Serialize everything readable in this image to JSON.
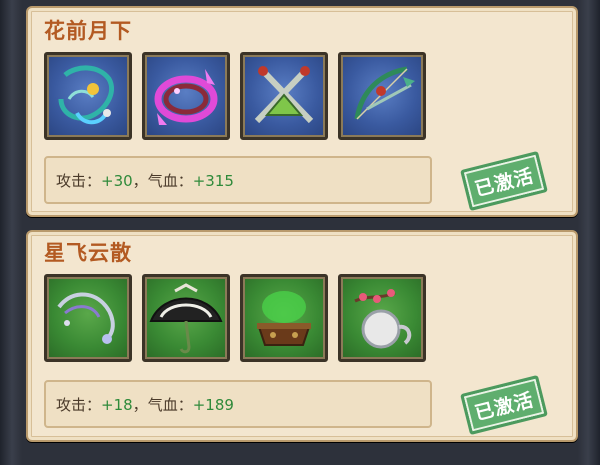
{
  "sets": [
    {
      "title": "花前月下",
      "items": [
        {
          "icon": "jade-pendant-icon",
          "bg": "blue"
        },
        {
          "icon": "purple-ring-blade-icon",
          "bg": "blue"
        },
        {
          "icon": "crossed-swords-icon",
          "bg": "blue"
        },
        {
          "icon": "bow-icon",
          "bg": "blue"
        }
      ],
      "stats": {
        "attack_label": "攻击：",
        "attack_value": "+30",
        "sep": "，",
        "hp_label": "气血：",
        "hp_value": "+315"
      },
      "status": "已激活"
    },
    {
      "title": "星飞云散",
      "items": [
        {
          "icon": "silver-whip-icon",
          "bg": "green"
        },
        {
          "icon": "umbrella-icon",
          "bg": "green"
        },
        {
          "icon": "cauldron-icon",
          "bg": "green"
        },
        {
          "icon": "blossom-orb-icon",
          "bg": "green"
        }
      ],
      "stats": {
        "attack_label": "攻击：",
        "attack_value": "+18",
        "sep": "，",
        "hp_label": "气血：",
        "hp_value": "+189"
      },
      "status": "已激活"
    }
  ]
}
